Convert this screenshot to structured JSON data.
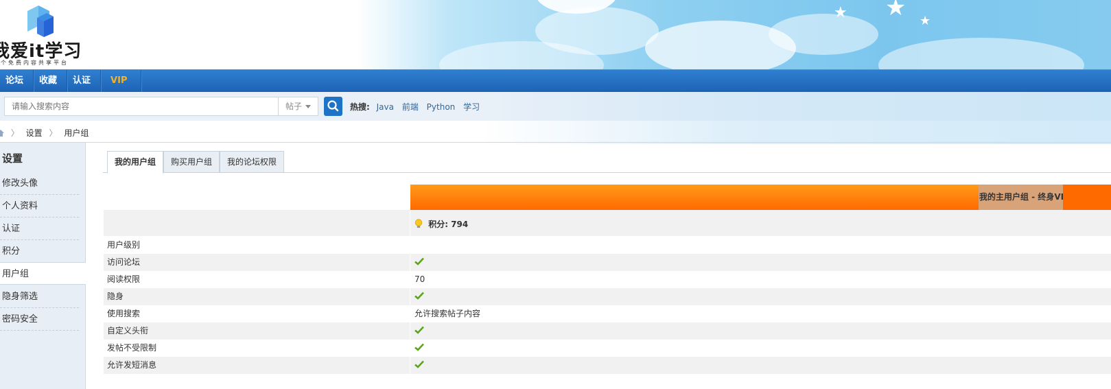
{
  "header": {
    "logo_text": "我爱it学习",
    "logo_subtitle": "一个免费内容共享平台"
  },
  "nav": {
    "items": [
      "论坛",
      "收藏",
      "认证",
      "VIP"
    ]
  },
  "search": {
    "placeholder": "请输入搜索内容",
    "type_selected": "帖子",
    "hot_label": "热搜:",
    "hot_keywords": [
      "Java",
      "前端",
      "Python",
      "学习"
    ]
  },
  "breadcrumb": {
    "items": [
      "设置",
      "用户组"
    ]
  },
  "sidebar": {
    "title": "设置",
    "items": [
      "修改头像",
      "个人资料",
      "认证",
      "积分",
      "用户组",
      "隐身筛选",
      "密码安全"
    ],
    "active_index": 4
  },
  "tabs": [
    "我的用户组",
    "购买用户组",
    "我的论坛权限"
  ],
  "usergroup": {
    "main_group_label": "我的主用户组 - 终身VIP",
    "points_label": "积分: 794",
    "rows": [
      {
        "key": "用户级别",
        "value": ""
      },
      {
        "key": "访问论坛",
        "value": "check"
      },
      {
        "key": "阅读权限",
        "value": "70"
      },
      {
        "key": "隐身",
        "value": "check"
      },
      {
        "key": "使用搜索",
        "value": "允许搜索帖子内容"
      },
      {
        "key": "自定义头衔",
        "value": "check"
      },
      {
        "key": "发帖不受限制",
        "value": "check"
      },
      {
        "key": "允许发短消息",
        "value": "check"
      }
    ]
  },
  "colors": {
    "nav_blue": "#1d63b5",
    "vip_orange": "#ff6a00",
    "vip_text": "#f5b323",
    "check_green": "#5aa51a"
  }
}
